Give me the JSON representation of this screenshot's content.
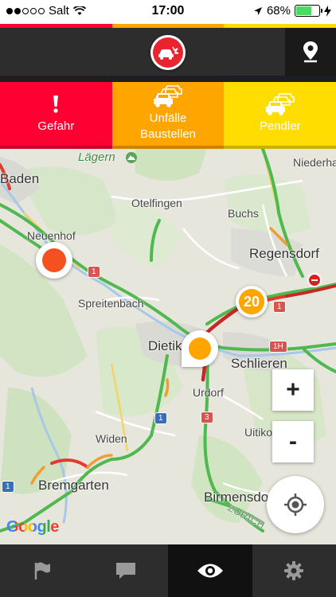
{
  "status_bar": {
    "carrier": "Salt",
    "time": "17:00",
    "battery_percent": "68%",
    "battery_level": 0.68,
    "signal_bars_filled": 2,
    "signal_bars_total": 5
  },
  "colors": {
    "red": "#ff0033",
    "orange": "#ffa500",
    "yellow": "#ffdd00",
    "header_bg": "#2d2d2d",
    "nav_active": "#111111"
  },
  "header": {
    "logo_icon": "traffic-accident-logo-icon",
    "locate_icon": "location-pin-icon"
  },
  "categories": [
    {
      "label": "Gefahr",
      "icon": "exclamation-icon"
    },
    {
      "label": "Unfälle\nBaustellen",
      "line1": "Unfälle",
      "line2": "Baustellen",
      "icon": "cars-icon"
    },
    {
      "label": "Pendler",
      "icon": "cars-icon"
    }
  ],
  "map": {
    "places": {
      "laegern": "Lägern",
      "niederhasli": "Niederha",
      "baden": "Baden",
      "otelfingen": "Otelfingen",
      "buchs": "Buchs",
      "neuenhof": "Neuenhof",
      "regensdorf": "Regensdorf",
      "spreitenbach": "Spreitenbach",
      "dietikon": "Dietik",
      "schlieren": "Schlieren",
      "urdorf": "Urdorf",
      "uitikon": "Uitiko",
      "widen": "Widen",
      "bremgarten": "Bremgarten",
      "birmensdorf": "Birmensdorf",
      "zurich": "ZURICH"
    },
    "shields": {
      "a1_main": "1",
      "a1_east": "1",
      "a1h": "1H",
      "a3": "3",
      "blue1": "1",
      "blue1_left": "1"
    },
    "cluster_count": "20",
    "zoom_in": "+",
    "zoom_out": "-",
    "google_logo": "Google"
  },
  "bottom_nav": [
    {
      "icon": "flag-icon",
      "active": false
    },
    {
      "icon": "chat-bubble-icon",
      "active": false
    },
    {
      "icon": "eye-icon",
      "active": true
    },
    {
      "icon": "gear-icon",
      "active": false
    }
  ]
}
